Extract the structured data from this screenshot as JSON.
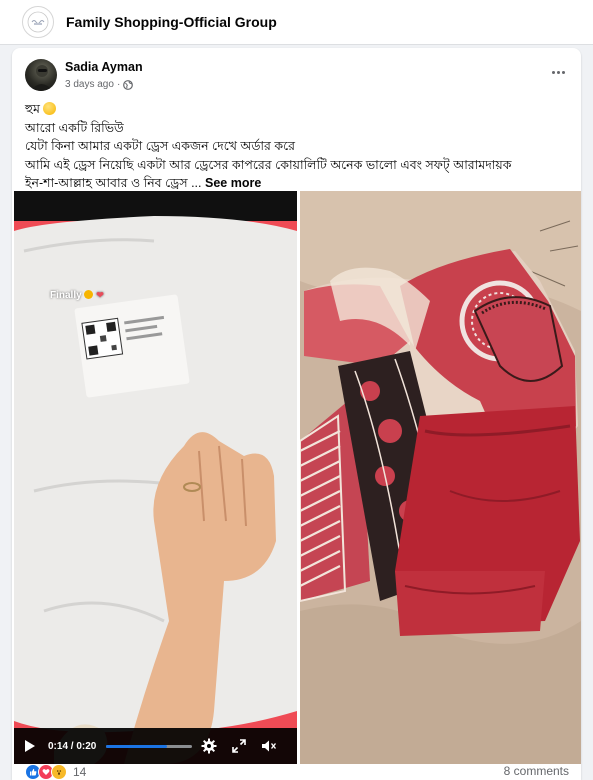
{
  "group": {
    "name": "Family Shopping-Official Group",
    "logo_icon": "group-logo-icon"
  },
  "post": {
    "author": "Sadia Ayman",
    "time": "3 days ago",
    "privacy_icon": "globe-icon",
    "text_lines": [
      "হুম",
      "আরো একটি রিভিউ",
      "যেটা কিনা আমার একটা ড্রেস একজন দেখে অর্ডার করে",
      "আমি এই ড্রেস নিয়েছি একটা আর ড্রেসের কাপরের কোয়ালিটি অনেক ভালো এবং সফট্ আরামদায়ক",
      "ইন-শা-আল্লাহ আবার ও নিব ড্রেস ..."
    ],
    "see_more": "See more",
    "video": {
      "overlay_text": "Finally",
      "time_display": "0:14 / 0:20",
      "progress": 0.7
    },
    "reactions": {
      "icons": [
        "like-icon",
        "love-icon",
        "wow-icon"
      ],
      "count": "14"
    },
    "comments": "8 comments"
  },
  "colors": {
    "brand_blue": "#1b74e4",
    "secondary_text": "#65676b"
  }
}
